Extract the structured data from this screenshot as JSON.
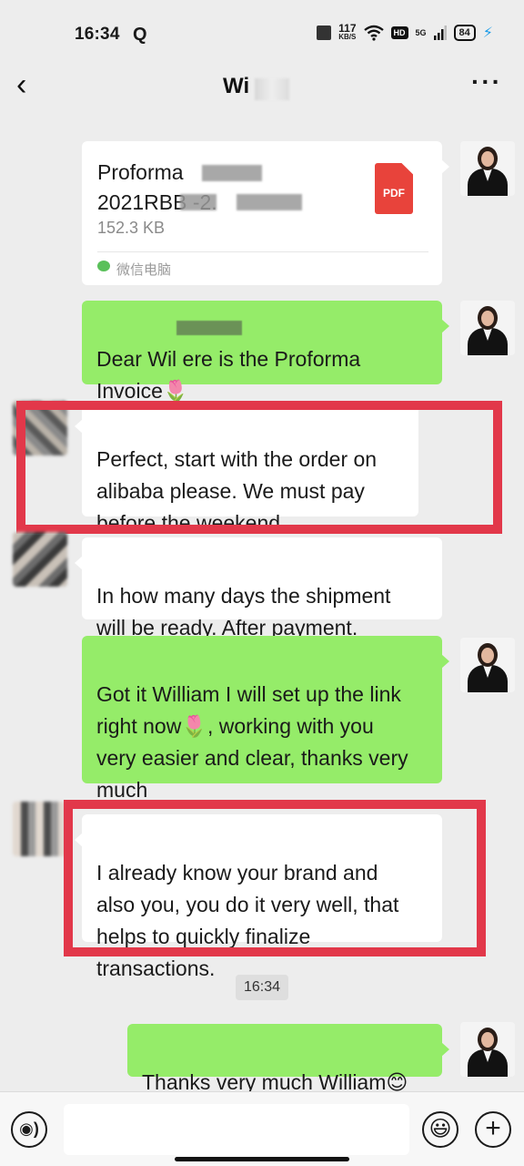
{
  "status_bar": {
    "time": "16:34",
    "app_badge": "Q",
    "net_speed": "117",
    "net_unit": "KB/S",
    "hd": "HD",
    "signal": "5G",
    "battery": "84"
  },
  "header": {
    "title": "Wi"
  },
  "file_message": {
    "name": "Proforma\n2021RBB                   -2.",
    "size": "152.3 KB",
    "type_label": "PDF",
    "source": "微信电脑"
  },
  "messages": [
    {
      "side": "right",
      "text": "Dear Wil          ere is the Proforma\nInvoice🌷"
    },
    {
      "side": "left",
      "text": "Perfect, start with the order on\nalibaba please. We must pay\nbefore the weekend."
    },
    {
      "side": "left",
      "text": "In how many days the shipment\nwill be ready. After payment."
    },
    {
      "side": "right",
      "text": "Got it William I will set up the link\nright now🌷, working with you\nvery easier and clear, thanks very\nmuch"
    },
    {
      "side": "left",
      "text": "I already know your brand and\nalso you, you do it very well, that\nhelps to quickly finalize\ntransactions."
    },
    {
      "side": "right",
      "text": "Thanks very much William😊"
    }
  ],
  "timestamp": "16:34",
  "input_bar": {
    "placeholder": "",
    "emoji_icon": "😃",
    "plus_icon": "+"
  },
  "colors": {
    "green_bubble": "#95ec69",
    "highlight": "#e2384a",
    "background": "#ededed"
  }
}
